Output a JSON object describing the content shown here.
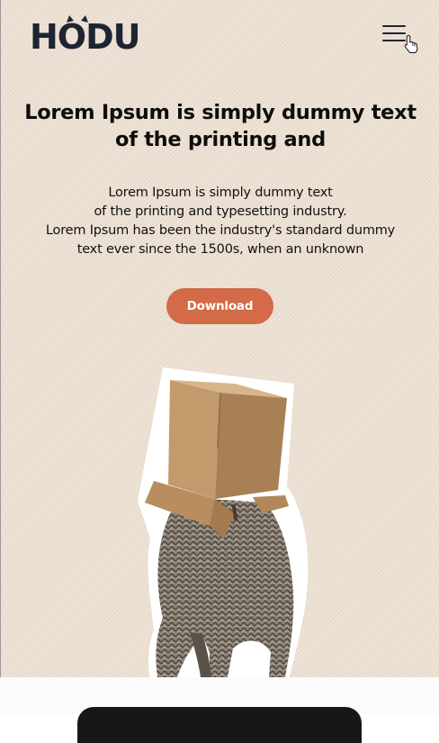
{
  "header": {
    "logo_text": "HODU",
    "menu_icon": "hamburger-menu-icon",
    "cursor_icon": "hand-pointer-icon"
  },
  "hero": {
    "title": "Lorem Ipsum is simply dummy text of the printing and",
    "description_lines": [
      "Lorem Ipsum is simply dummy text",
      "of the printing and typesetting industry.",
      "Lorem Ipsum has been the industry's standard dummy",
      "text ever since the 1500s, when an unknown"
    ],
    "download_label": "Download",
    "image_icon": "cat-in-box-illustration"
  },
  "colors": {
    "background": "#ece0d1",
    "accent": "#d36a48",
    "logo": "#1e2532",
    "text": "#0d0d0d"
  }
}
